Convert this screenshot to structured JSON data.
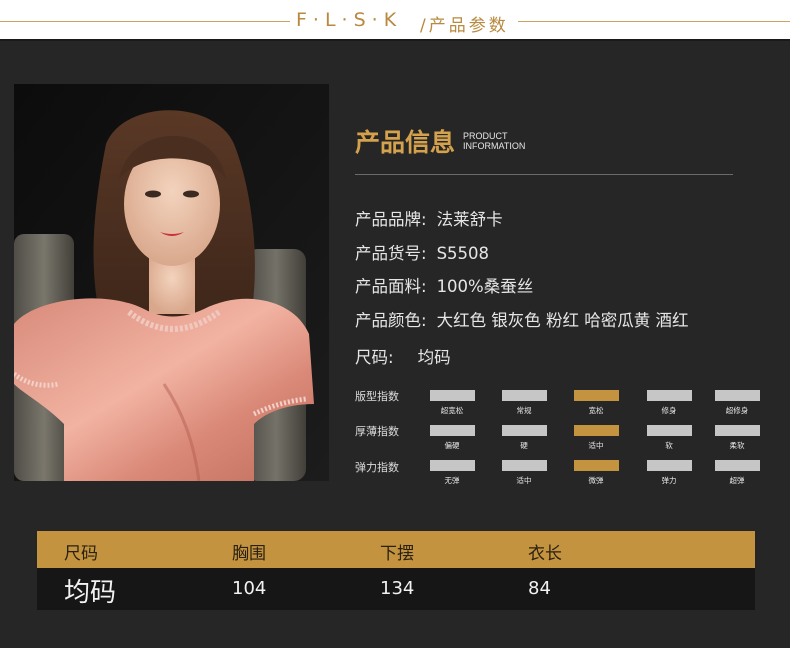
{
  "header": {
    "brand": "F·L·S·K",
    "separator": "/",
    "title": "产品参数"
  },
  "info": {
    "title_cn": "产品信息",
    "title_en_1": "PRODUCT",
    "title_en_2": "INFORMATION"
  },
  "specs": [
    {
      "key": "产品品牌:",
      "value": "法莱舒卡"
    },
    {
      "key": "产品货号:",
      "value": "S5508"
    },
    {
      "key": "产品面料:",
      "value": "100%桑蚕丝"
    },
    {
      "key": "产品颜色:",
      "value": "大红色 银灰色 粉红 哈密瓜黄 酒红"
    },
    {
      "key": "尺码:",
      "value": "均码"
    }
  ],
  "indices": [
    {
      "label": "版型指数",
      "options": [
        "超宽松",
        "常规",
        "宽松",
        "修身",
        "超修身"
      ],
      "selected": 2
    },
    {
      "label": "厚薄指数",
      "options": [
        "偏硬",
        "硬",
        "适中",
        "软",
        "柔软"
      ],
      "selected": 2
    },
    {
      "label": "弹力指数",
      "options": [
        "无弹",
        "适中",
        "微弹",
        "弹力",
        "超弹"
      ],
      "selected": 2
    }
  ],
  "colors": {
    "accent": "#c4933f",
    "bar_off": "#c6c6c6",
    "background": "#262626"
  },
  "size_table": {
    "headers": [
      "尺码",
      "胸围",
      "下摆",
      "衣长"
    ],
    "row": [
      "均码",
      "104",
      "134",
      "84"
    ]
  }
}
